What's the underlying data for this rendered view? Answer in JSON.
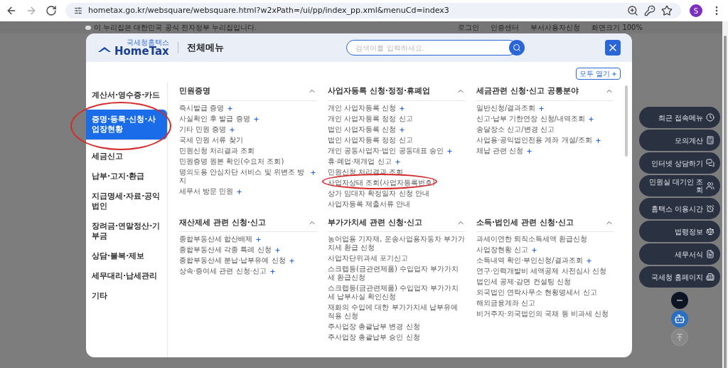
{
  "browser": {
    "url": "hometax.go.kr/websquare/websquare.html?w2xPath=/ui/pp/index_pp.xml&menuCd=index3",
    "profile": "S"
  },
  "page_top": {
    "notice": "이 누리집은 대한민국 공식 전자정부 누리집입니다.",
    "links": [
      "로그인",
      "인증센터",
      "부서사용자신청"
    ],
    "zoom": "화면크기 100%"
  },
  "modal": {
    "logo_small": "국세청홈택스",
    "logo": "HomeTax",
    "title": "전체메뉴",
    "search": {
      "placeholder": "검색어를 입력하세요."
    },
    "expand_all": "모두 열기",
    "sidebar": [
      {
        "label": "계산서·영수증·카드",
        "selected": false
      },
      {
        "label": "증명·등록·신청·사업장현황",
        "selected": true
      },
      {
        "label": "세금신고",
        "selected": false
      },
      {
        "label": "납부·고지·환급",
        "selected": false
      },
      {
        "label": "지급명세·자료·공익법인",
        "selected": false
      },
      {
        "label": "장려금·연말정산·기부금",
        "selected": false
      },
      {
        "label": "상담·불복·제보",
        "selected": false
      },
      {
        "label": "세무대리·납세관리",
        "selected": false
      },
      {
        "label": "기타",
        "selected": false
      }
    ],
    "sections": [
      {
        "title": "민원증명",
        "expanded": true,
        "items": [
          {
            "text": "즉시발급 증명",
            "plus": true
          },
          {
            "text": "사실확인 후 발급 증명",
            "plus": true
          },
          {
            "text": "기타 민원 증명",
            "plus": true
          },
          {
            "text": "국세 민원 서류 찾기",
            "plus": false
          },
          {
            "text": "민원신청 처리결과 조회",
            "plus": false
          },
          {
            "text": "민원증명 원본 확인(수요처 조회)",
            "plus": false
          },
          {
            "text": "명의도용 안심차단 서비스 및 위변조 방지",
            "plus": true
          },
          {
            "text": "세무서 방문 민원",
            "plus": true
          }
        ]
      },
      {
        "title": "사업자등록 신청·정정·휴폐업",
        "expanded": true,
        "items": [
          {
            "text": "개인 사업자등록 신청",
            "plus": true
          },
          {
            "text": "개인 사업자등록 정정 신고",
            "plus": false
          },
          {
            "text": "법인 사업자등록 신청",
            "plus": true
          },
          {
            "text": "법인 사업자등록 정정 신고",
            "plus": false
          },
          {
            "text": "개인 공동사업자·법인 공동대표 승인",
            "plus": true
          },
          {
            "text": "휴·폐업·재개업 신고",
            "plus": true
          },
          {
            "text": "민원신청 처리결과 조회",
            "plus": false
          },
          {
            "text": "사업자상태 조회(사업자등록번호)",
            "plus": false
          },
          {
            "text": "상가 임대차 확정일자 신청 안내",
            "plus": false
          },
          {
            "text": "사업자등록 제출서류 안내",
            "plus": false
          }
        ]
      },
      {
        "title": "세금관련 신청·신고 공통분야",
        "expanded": true,
        "items": [
          {
            "text": "일반신청/결과조회",
            "plus": true
          },
          {
            "text": "신고·납부 기한연장 신청/내역조회",
            "plus": true
          },
          {
            "text": "송달장소 신고/변경 신고",
            "plus": false
          },
          {
            "text": "사업용·공익법인전용 계좌 개설/조회",
            "plus": true
          },
          {
            "text": "체납 관련 신청",
            "plus": true
          }
        ]
      },
      {
        "title": "재산제세 관련 신청·신고",
        "expanded": true,
        "items": [
          {
            "text": "종합부동산세 합산배제",
            "plus": true
          },
          {
            "text": "종합부동산세 각종 특례 신청",
            "plus": true
          },
          {
            "text": "종합부동산세 분납·납부유예 신청",
            "plus": true
          },
          {
            "text": "상속·증여세 관련 신청·신고",
            "plus": true
          }
        ]
      },
      {
        "title": "부가가치세 관련 신청·신고",
        "expanded": true,
        "items": [
          {
            "text": "농어업용 기자재, 운송사업용자동차 부가가치세 환급 신청",
            "plus": false
          },
          {
            "text": "사업자단위과세 포기신고",
            "plus": false
          },
          {
            "text": "스크랩등(금관련제품) 수입업자 부가가치세 환급신청",
            "plus": false
          },
          {
            "text": "스크랩등(금관련제품) 수입업자 부가가치세 납부사실 확인신청",
            "plus": false
          },
          {
            "text": "재화의 수입에 대한 부가가치세 납부유예 적용 신청",
            "plus": false
          },
          {
            "text": "주사업장 총괄납부 변경 신청",
            "plus": false
          },
          {
            "text": "주사업장 총괄납부 승인 신청",
            "plus": false
          }
        ]
      },
      {
        "title": "소득·법인세 관련 신청·신고",
        "expanded": true,
        "items": [
          {
            "text": "과세이연한 퇴직소득세액 환급신청",
            "plus": false
          },
          {
            "text": "사업장현황 신고",
            "plus": true
          },
          {
            "text": "소득내역 확인·부인신청/결과조회",
            "plus": true
          },
          {
            "text": "연구·인력개발비 세액공제 사전심사 신청",
            "plus": false
          },
          {
            "text": "법인세 공제·감면 컨설팅 신청",
            "plus": false
          },
          {
            "text": "외국법인 연락사무소 현황명세서 신고",
            "plus": false
          },
          {
            "text": "해외금융계좌 신고",
            "plus": false
          },
          {
            "text": "비거주자·외국법인의 국채 등 비과세 신청",
            "plus": false
          }
        ]
      }
    ]
  },
  "quick_menu": [
    "최근 접속메뉴",
    "모의계산",
    "인터넷 상담하기",
    "민원실 대기인 조회",
    "홈택스 이용시간",
    "법령정보",
    "세무서식",
    "국세청 홈페이지"
  ]
}
